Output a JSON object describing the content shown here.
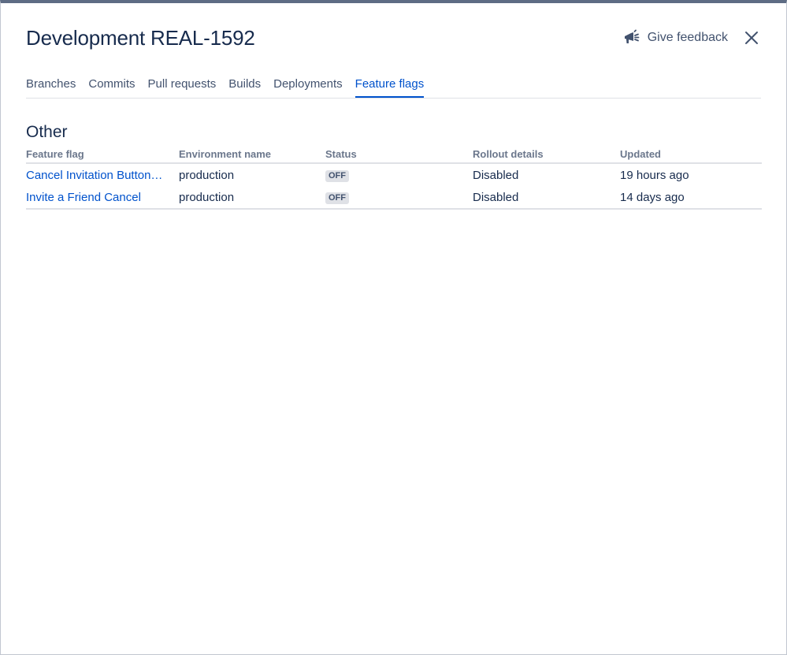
{
  "header": {
    "title": "Development REAL-1592",
    "feedback_label": "Give feedback",
    "feedback_icon": "megaphone-icon",
    "close_icon": "close-icon"
  },
  "tabs": [
    {
      "label": "Branches",
      "active": false
    },
    {
      "label": "Commits",
      "active": false
    },
    {
      "label": "Pull requests",
      "active": false
    },
    {
      "label": "Builds",
      "active": false
    },
    {
      "label": "Deployments",
      "active": false
    },
    {
      "label": "Feature flags",
      "active": true
    }
  ],
  "section": {
    "title": "Other"
  },
  "table": {
    "columns": [
      "Feature flag",
      "Environment name",
      "Status",
      "Rollout details",
      "Updated"
    ],
    "rows": [
      {
        "flag": "Cancel Invitation Button…",
        "environment": "production",
        "status": "OFF",
        "rollout": "Disabled",
        "updated": "19 hours ago"
      },
      {
        "flag": "Invite a Friend Cancel",
        "environment": "production",
        "status": "OFF",
        "rollout": "Disabled",
        "updated": "14 days ago"
      }
    ]
  },
  "colors": {
    "accent": "#0052cc",
    "text": "#172b4d",
    "muted": "#6b778c",
    "lozenge_bg": "#dfe1e6"
  }
}
